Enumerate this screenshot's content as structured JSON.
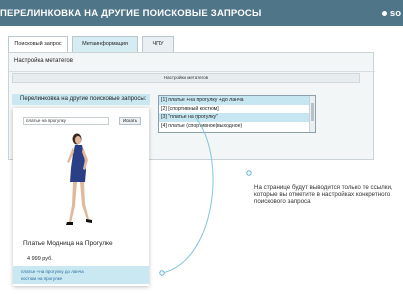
{
  "header": {
    "title": "ПЕРЕЛИНКОВКА НА ДРУГИЕ ПОИСКОВЫЕ ЗАПРОСЫ",
    "logo": "so",
    "color": "#4f7589"
  },
  "tabs": [
    {
      "label": "Поисковый запрос",
      "active": true
    },
    {
      "label": "Метаинформация",
      "active": false
    },
    {
      "label": "ЧПУ",
      "active": false
    }
  ],
  "meta": {
    "title": "Настройка метатегов",
    "button": "Настройки метатегов"
  },
  "crosslink": {
    "label": "Перелинковка на другие поисковые запросы:",
    "items": [
      {
        "text": "[1] платье +на прогулку +до ланча",
        "selected": true
      },
      {
        "text": "[2] [спортивный костюм]",
        "selected": false
      },
      {
        "text": "[3] \"платье на прогулку\"",
        "selected": true
      },
      {
        "text": "[4] платье (спортивное|выходное)",
        "selected": false
      }
    ]
  },
  "product_card": {
    "search_value": "платье на прогулку",
    "search_button": "Искать",
    "name": "Платье Модница на Прогулке",
    "price": "4 999 руб.",
    "links": [
      "платье +на прогулку до ланча",
      "костюм на прогулке"
    ]
  },
  "note": "На странице будут выводится только те ссылки, которые вы отметите в настройках конкретного поискового запроса",
  "accent_color": "#c9e8f2"
}
